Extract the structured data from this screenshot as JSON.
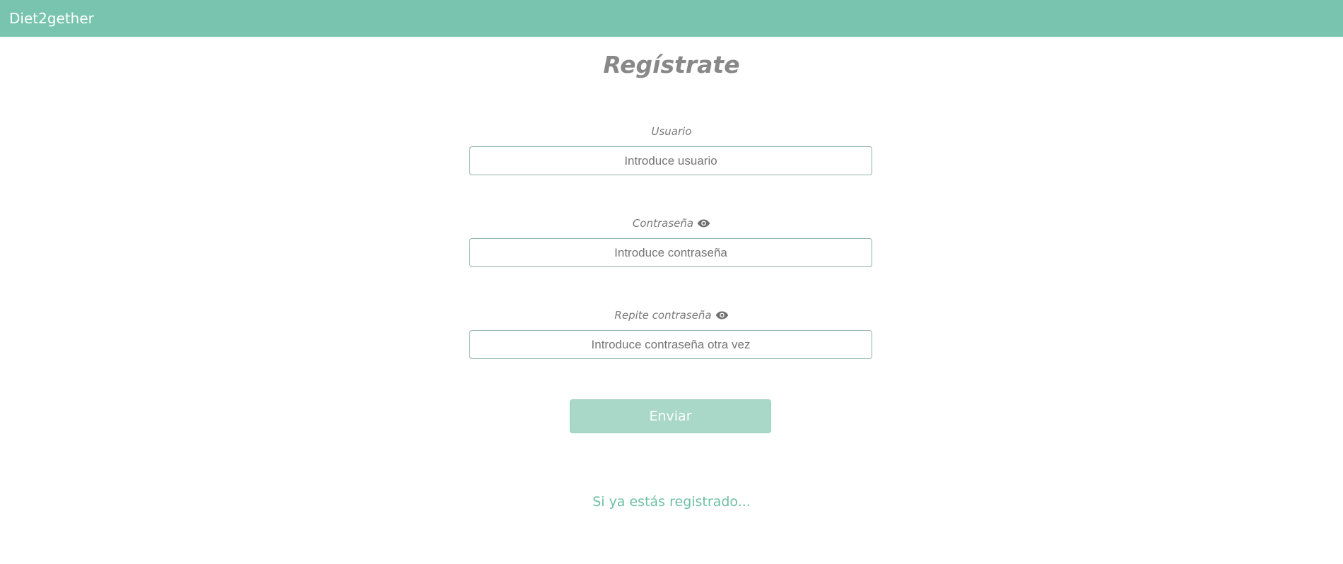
{
  "navbar": {
    "brand": "Diet2gether"
  },
  "title": "Regístrate",
  "form": {
    "username": {
      "label": "Usuario",
      "placeholder": "Introduce usuario",
      "value": ""
    },
    "password": {
      "label": "Contraseña",
      "placeholder": "Introduce contraseña",
      "value": "",
      "icon": "eye-icon"
    },
    "repeat_password": {
      "label": "Repite contraseña",
      "placeholder": "Introduce contraseña otra vez",
      "value": "",
      "icon": "eye-icon"
    },
    "submit_label": "Enviar"
  },
  "login_link": "Si ya estás registrado...",
  "colors": {
    "navbar": "#78c4ae",
    "button": "#a9d8c9",
    "link": "#6fc0a5",
    "title": "#888888"
  }
}
